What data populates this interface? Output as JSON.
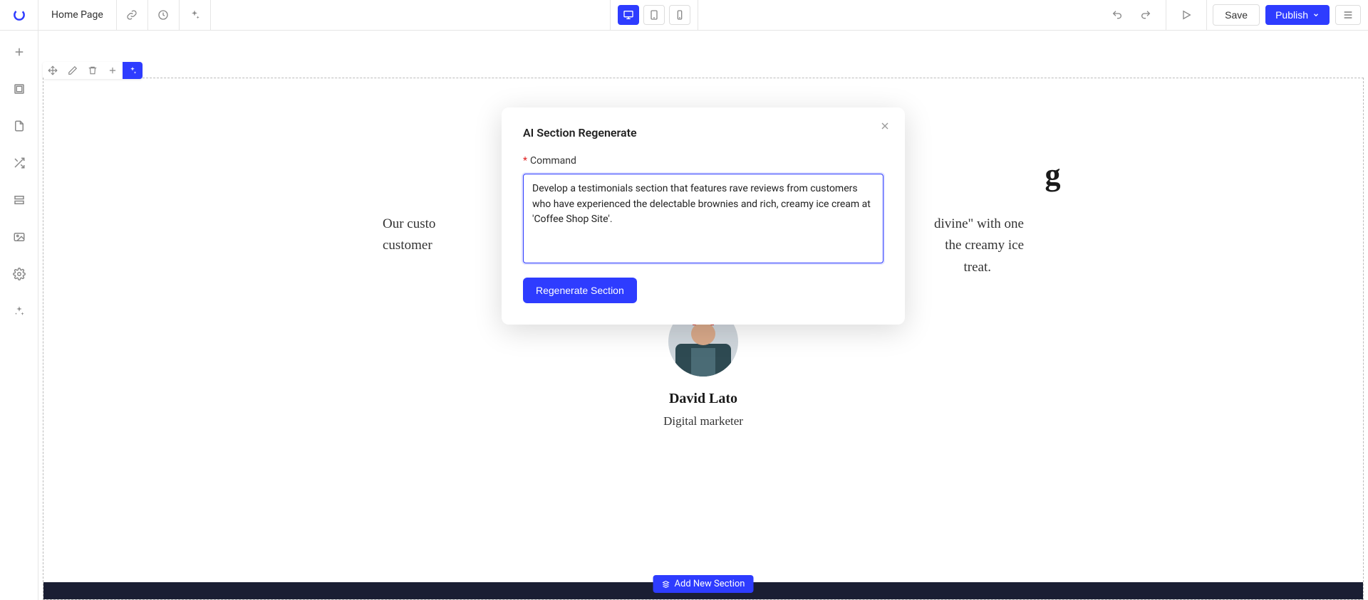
{
  "header": {
    "page_title": "Home Page",
    "save_label": "Save",
    "publish_label": "Publish"
  },
  "modal": {
    "title": "AI Section Regenerate",
    "command_label": "Command",
    "command_value": "Develop a testimonials section that features rave reviews from customers who have experienced the delectable brownies and rich, creamy ice cream at 'Coffee Shop Site'.",
    "submit_label": "Regenerate Section"
  },
  "section": {
    "heading_visible_fragment": "g",
    "body_left": "Our custo",
    "body_right_1": "divine\" with one",
    "body_left_2": "customer",
    "body_right_2": "the creamy ice",
    "body_right_3": "treat.",
    "person_name": "David Lato",
    "person_role": "Digital marketer"
  },
  "add_section_label": "Add New Section",
  "icons": {
    "plus": "plus",
    "page": "page",
    "shuffle": "shuffle",
    "layers": "layers",
    "image": "image",
    "gear": "gear",
    "sparkle": "sparkle",
    "link": "link",
    "clock": "clock",
    "desktop": "desktop",
    "tablet": "tablet",
    "mobile": "mobile",
    "undo": "undo",
    "redo": "redo",
    "play": "play",
    "chevron": "chevron-down",
    "menu": "menu",
    "move": "move",
    "edit": "edit",
    "trash": "trash",
    "close": "close"
  }
}
